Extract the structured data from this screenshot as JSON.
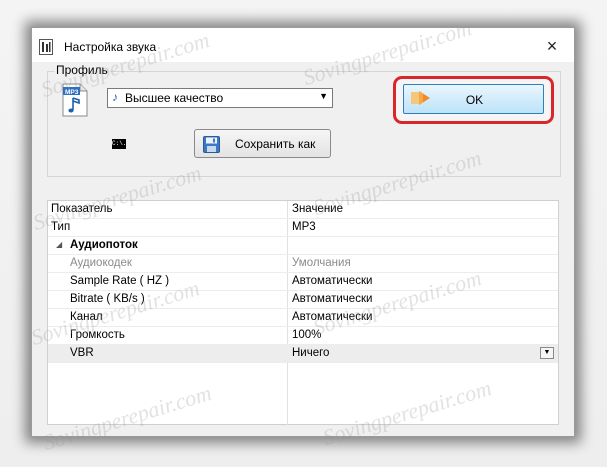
{
  "window": {
    "title": "Настройка звука",
    "close_label": "×"
  },
  "profile": {
    "legend": "Профиль",
    "file_icon_label": "MP3",
    "selected_quality": "Высшее качество",
    "cmd_icon_label": "C:\\."
  },
  "buttons": {
    "ok_label": "OK",
    "save_label": "Сохранить как"
  },
  "grid": {
    "headers": {
      "key": "Показатель",
      "value": "Значение"
    },
    "rows": [
      {
        "key": "Тип",
        "value": "MP3"
      },
      {
        "key": "Аудиопоток",
        "value": ""
      },
      {
        "key": "Аудиокодек",
        "value": "Умолчания"
      },
      {
        "key": "Sample Rate ( HZ )",
        "value": "Автоматически"
      },
      {
        "key": "Bitrate ( KB/s )",
        "value": "Автоматически"
      },
      {
        "key": "Канал",
        "value": "Автоматически"
      },
      {
        "key": "Громкость",
        "value": "100%"
      },
      {
        "key": "VBR",
        "value": "Ничего"
      }
    ]
  },
  "watermark": "Sovingperepair.com",
  "colors": {
    "highlight": "#d8262b",
    "ok_border": "#2f7fbf",
    "window_bg": "#f0f0f0"
  },
  "icons": [
    "app-icon",
    "mp3-file-icon",
    "music-note-icon",
    "chevron-down-icon",
    "ok-arrow-icon",
    "cmd-icon",
    "floppy-save-icon",
    "collapse-triangle-icon",
    "dropdown-arrow-icon",
    "close-icon"
  ]
}
